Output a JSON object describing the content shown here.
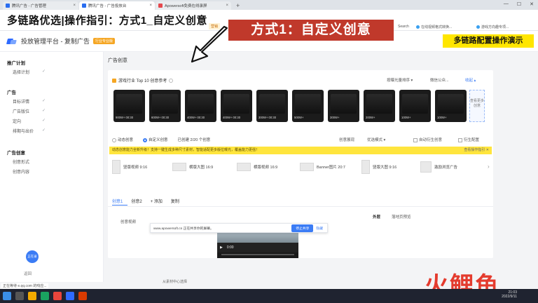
{
  "browser": {
    "tabs": [
      {
        "label": "腾讯广告 - 广告管理",
        "active": false
      },
      {
        "label": "腾讯广告 - 广告投放台",
        "active": true
      },
      {
        "label": "Apowersoft免费在线录屏",
        "active": false
      }
    ],
    "new_tab": "+",
    "window_controls": {
      "min": "—",
      "max": "☐",
      "close": "✕"
    },
    "bookmarks": [
      {
        "label": "Search",
        "x_hint": "search"
      },
      {
        "label": "在线视频格式转换..."
      },
      {
        "label": "游戏方向趣专项..."
      }
    ]
  },
  "overlay_title": "多链路优选|操作指引：方式1_自定义创意",
  "red_banner": "方式1：自定义创意",
  "yellow_banner": "多链路配置操作演示",
  "orange_tag": "营销",
  "app_header": {
    "title": "投放管理平台 - 复制广告",
    "badge": "行业专业版"
  },
  "sidebar": {
    "groups": [
      {
        "label": "推广计划",
        "items": [
          {
            "label": "选择计划",
            "checked": true
          }
        ]
      },
      {
        "label": "广告",
        "items": [
          {
            "label": "目标详情",
            "checked": true
          },
          {
            "label": "广告版位",
            "checked": true
          },
          {
            "label": "定向",
            "checked": true
          },
          {
            "label": "排期与出价",
            "checked": true
          }
        ]
      },
      {
        "label": "广告创意",
        "items": [
          {
            "label": "创意形式",
            "checked": false
          },
          {
            "label": "创意内容",
            "checked": false
          }
        ]
      }
    ],
    "check_glyph": "✓",
    "avatar_text": "正在录",
    "help_label": "返回"
  },
  "main": {
    "title": "广告创意",
    "top10": {
      "label": "游戏行业 Top 10 创意参考",
      "sort": "按曝光量排序 ▾",
      "filter": "微信公众...",
      "toggle": "收起 ▴",
      "thumbs": [
        {
          "label": "900W+  00:30"
        },
        {
          "label": "600W+  00:30"
        },
        {
          "label": "400W+  00:30"
        },
        {
          "label": "400W+  00:30"
        },
        {
          "label": "300W+  00:30"
        },
        {
          "label": "500W+"
        },
        {
          "label": "300W+"
        },
        {
          "label": "200W+"
        },
        {
          "label": "100W+"
        },
        {
          "label": "100W+"
        }
      ],
      "more": "查看更多创意"
    },
    "mode": {
      "options": [
        {
          "label": "动态创意",
          "selected": false
        },
        {
          "label": "自定义创意",
          "selected": true
        }
      ],
      "count": "已创建 2/20 个创意",
      "right_items": [
        "创意展现",
        "优选模式 ▾",
        "自动衍生创意",
        "衍生配置"
      ]
    },
    "notice": {
      "text": "动态创意能力全新升级！支持一键生成多种尺寸素材，智能适配更多版位曝光，覆盖能力更强！",
      "link": "",
      "right": "查看操作指引 ✕"
    },
    "formats": [
      {
        "label": "竖版视频 9:16",
        "shape": "tall"
      },
      {
        "label": "横版大图 16:9",
        "shape": "wide"
      },
      {
        "label": "横版视频 16:9",
        "shape": "wide"
      },
      {
        "label": "Banner图片 20:7",
        "shape": "wide"
      },
      {
        "label": "竖版大图 9:16",
        "shape": "tall"
      },
      {
        "label": "激励浏览广告",
        "shape": "sq"
      }
    ],
    "format_next": "›",
    "creative_tabs": {
      "tab1": "创意1",
      "tab2": "创意2",
      "add": "+ 添加",
      "copy": "复制"
    },
    "creative_label": "创意视频",
    "preview_tabs": [
      "外层",
      "落地页预览"
    ],
    "video": {
      "time": "0:00",
      "play": "▶"
    },
    "material_link": "从素材中心选择"
  },
  "share_bar": {
    "text": "www.apowersoft.cn 正在共享你的屏幕。",
    "stop": "停止共享",
    "hide": "隐藏"
  },
  "status_left": "正在等待 e.qq.com 的响应...",
  "watermark": "火鲤鱼",
  "taskbar": {
    "time": "21:03",
    "date": "2022/9/11"
  },
  "colors": {
    "red_banner": "#c0392b",
    "yellow_banner": "#ffe600",
    "accent": "#3b7cf5",
    "watermark": "#e43b2e"
  }
}
